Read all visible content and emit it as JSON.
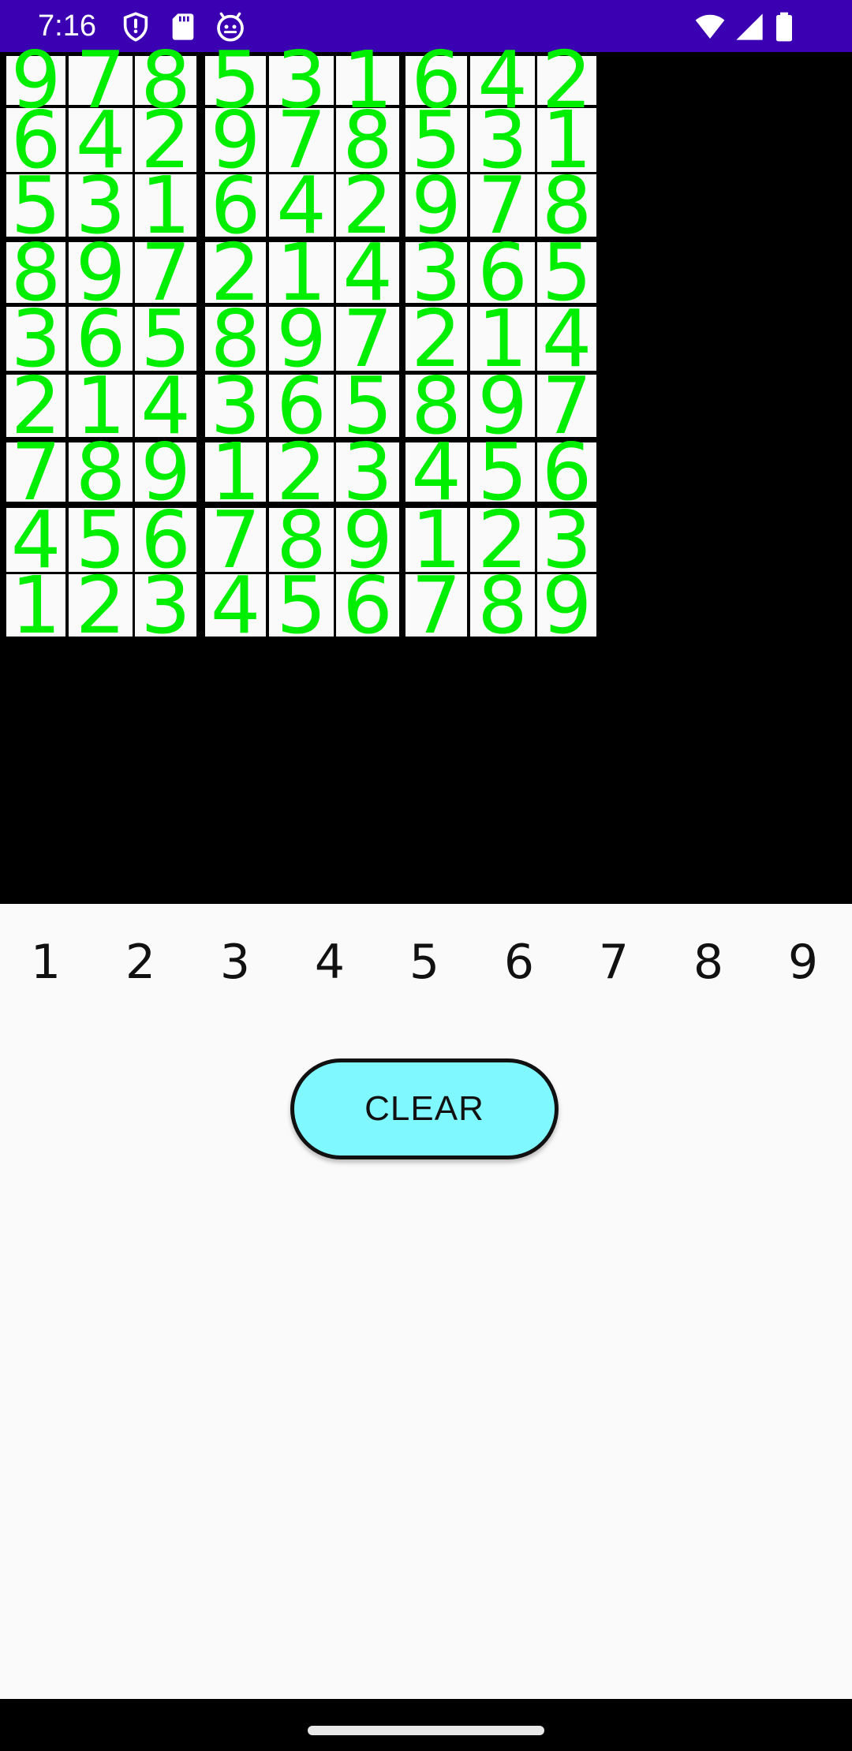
{
  "status_bar": {
    "time": "7:16",
    "left_icons": [
      "shield-icon",
      "sd-card-icon",
      "android-face-icon"
    ],
    "right_icons": [
      "wifi-icon",
      "cell-signal-icon",
      "battery-icon"
    ],
    "background": "#3c00b3"
  },
  "board": {
    "digit_color": "#00ee00",
    "grid": [
      [
        9,
        7,
        8,
        5,
        3,
        1,
        6,
        4,
        2
      ],
      [
        6,
        4,
        2,
        9,
        7,
        8,
        5,
        3,
        1
      ],
      [
        5,
        3,
        1,
        6,
        4,
        2,
        9,
        7,
        8
      ],
      [
        8,
        9,
        7,
        2,
        1,
        4,
        3,
        6,
        5
      ],
      [
        3,
        6,
        5,
        8,
        9,
        7,
        2,
        1,
        4
      ],
      [
        2,
        1,
        4,
        3,
        6,
        5,
        8,
        9,
        7
      ],
      [
        7,
        8,
        9,
        1,
        2,
        3,
        4,
        5,
        6
      ],
      [
        4,
        5,
        6,
        7,
        8,
        9,
        1,
        2,
        3
      ],
      [
        1,
        2,
        3,
        4,
        5,
        6,
        7,
        8,
        9
      ]
    ]
  },
  "number_picker": [
    "1",
    "2",
    "3",
    "4",
    "5",
    "6",
    "7",
    "8",
    "9"
  ],
  "clear_button": {
    "label": "CLEAR",
    "background": "#80f8ff"
  }
}
